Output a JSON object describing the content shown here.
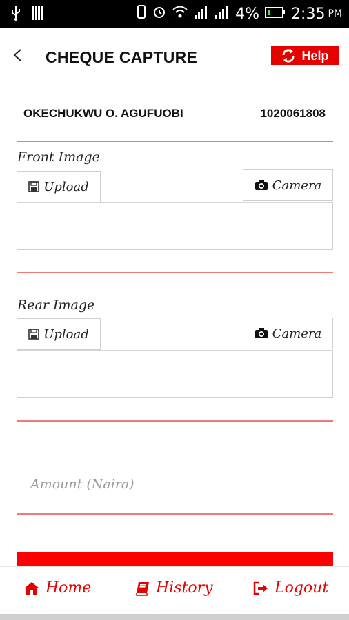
{
  "status_bar": {
    "battery_percent": "4%",
    "time": "2:35",
    "ampm": "PM",
    "icons": [
      "usb-icon",
      "barcode-icon",
      "vibrate-icon",
      "alarm-icon",
      "wifi-icon",
      "signal-icon",
      "signal-icon",
      "battery-icon"
    ]
  },
  "header": {
    "title": "CHEQUE CAPTURE",
    "help_label": "Help",
    "back_icon": "chevron-left-icon",
    "help_icon": "refresh-icon"
  },
  "account": {
    "name": "OKECHUKWU O. AGUFUOBI",
    "number": "1020061808"
  },
  "front_image": {
    "label": "Front Image",
    "upload_label": "Upload",
    "camera_label": "Camera"
  },
  "rear_image": {
    "label": "Rear Image",
    "upload_label": "Upload",
    "camera_label": "Camera"
  },
  "amount": {
    "placeholder": "Amount (Naira)"
  },
  "bottom_nav": {
    "items": [
      {
        "label": "Home",
        "icon": "home-icon"
      },
      {
        "label": "History",
        "icon": "book-icon"
      },
      {
        "label": "Logout",
        "icon": "logout-icon"
      }
    ]
  },
  "colors": {
    "accent": "#e60000",
    "divider": "#f07a7a",
    "status_bar": "#000000"
  }
}
